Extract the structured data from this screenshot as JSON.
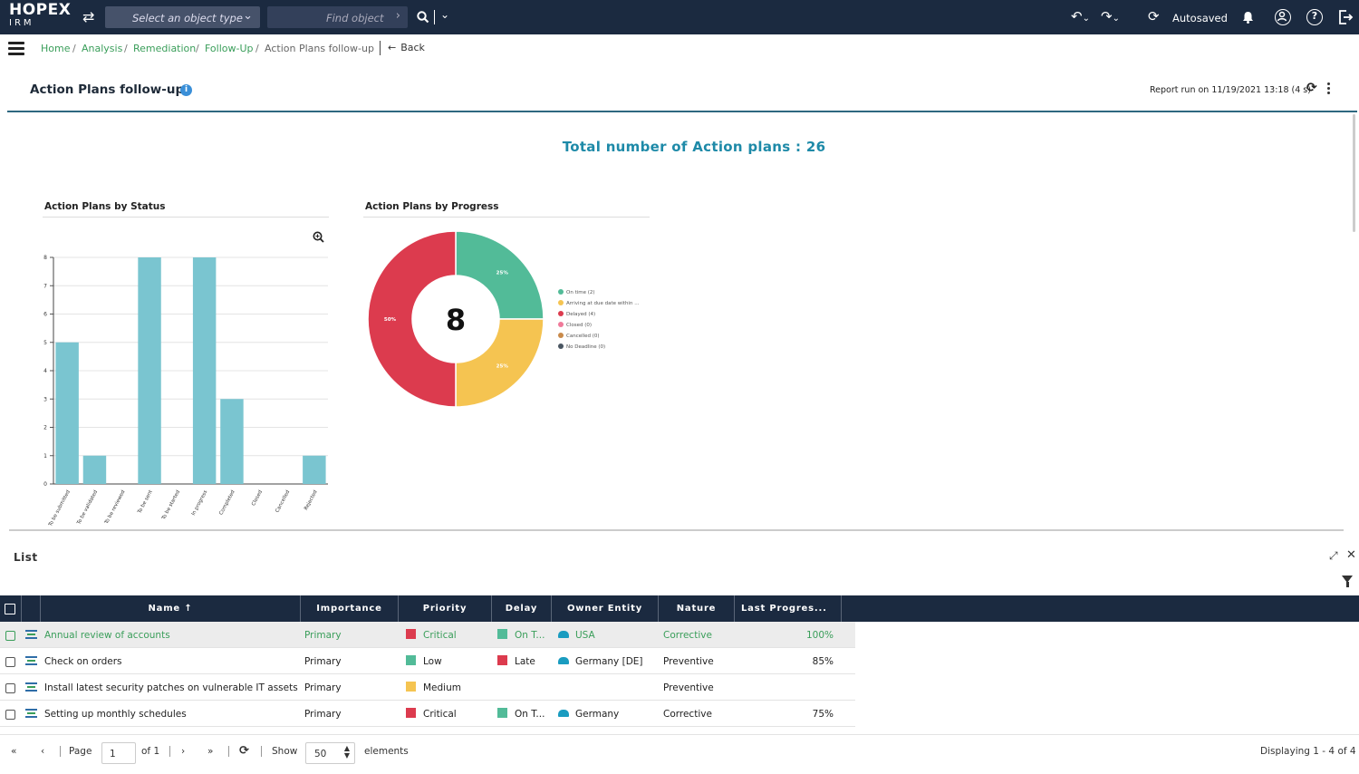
{
  "app": {
    "logo": "HOPEX",
    "logo_sub": "IRM"
  },
  "topbar": {
    "select_type_placeholder": "Select an object type",
    "find_placeholder": "Find object",
    "autosaved": "Autosaved",
    "help_symbol": "?",
    "icons": [
      "swap-icon",
      "chevron-down-icon",
      "chevron-right-icon",
      "search-icon",
      "undo-icon",
      "redo-icon",
      "sync-icon",
      "bell-icon",
      "user-icon",
      "help-icon",
      "logout-icon"
    ]
  },
  "breadcrumb": {
    "items": [
      "Home",
      "Analysis",
      "Remediation",
      "Follow-Up",
      "Action Plans follow-up"
    ],
    "separator": "/",
    "back": "Back"
  },
  "page": {
    "title": "Action Plans follow-up",
    "info_symbol": "i",
    "report_run": "Report run on 11/19/2021 13:18 (4 s)",
    "total": "Total number of Action plans : 26"
  },
  "charts": {
    "bar_title": "Action Plans by Status",
    "donut_title": "Action Plans by Progress"
  },
  "chart_data": [
    {
      "type": "bar",
      "title": "Action Plans by Status",
      "categories": [
        "To be submitted",
        "To be validated",
        "To be reviewed",
        "To be sent",
        "To be started",
        "In progress",
        "Completed",
        "Closed",
        "Cancelled",
        "Rejected"
      ],
      "values": [
        5,
        1,
        0,
        8,
        0,
        8,
        3,
        0,
        0,
        1
      ],
      "ylim": [
        0,
        8
      ],
      "yticks": [
        0,
        1,
        2,
        3,
        4,
        5,
        6,
        7,
        8
      ],
      "grid": true,
      "color": "#7ac5d0"
    },
    {
      "type": "pie",
      "title": "Action Plans by Progress",
      "center_label": "8",
      "labels": [
        "On time (2)",
        "Arriving at due date within ...",
        "Delayed (4)",
        "Closed (0)",
        "Cancelled (0)",
        "No Deadline (0)"
      ],
      "values": [
        2,
        2,
        4,
        0,
        0,
        0
      ],
      "percent_labels": [
        "25%",
        "25%",
        "50%",
        "",
        "",
        ""
      ],
      "colors": [
        "#52bb98",
        "#f5c451",
        "#dc3b4e",
        "#f07a9a",
        "#c98a4a",
        "#4a5662"
      ],
      "legend": "right"
    }
  ],
  "list": {
    "title": "List",
    "columns": [
      "Name",
      "Importance",
      "Priority",
      "Delay",
      "Owner Entity",
      "Nature",
      "Last Progres..."
    ],
    "sort_indicator": "↑",
    "rows": [
      {
        "name": "Annual review of accounts",
        "importance": "Primary",
        "priority": "Critical",
        "priority_color": "#dc3b4e",
        "delay": "On T...",
        "delay_color": "#52bb98",
        "entity": "USA",
        "nature": "Corrective",
        "progress": "100%",
        "selected": true
      },
      {
        "name": "Check on orders",
        "importance": "Primary",
        "priority": "Low",
        "priority_color": "#52bb98",
        "delay": "Late",
        "delay_color": "#dc3b4e",
        "entity": "Germany [DE]",
        "nature": "Preventive",
        "progress": "85%",
        "selected": false
      },
      {
        "name": "Install latest security patches on vulnerable IT assets",
        "importance": "Primary",
        "priority": "Medium",
        "priority_color": "#f5c451",
        "delay": "",
        "delay_color": "",
        "entity": "",
        "nature": "Preventive",
        "progress": "",
        "selected": false
      },
      {
        "name": "Setting up monthly schedules",
        "importance": "Primary",
        "priority": "Critical",
        "priority_color": "#dc3b4e",
        "delay": "On T...",
        "delay_color": "#52bb98",
        "entity": "Germany",
        "nature": "Corrective",
        "progress": "75%",
        "selected": false
      }
    ]
  },
  "footer": {
    "page_label": "Page",
    "page_value": "1",
    "of": "of 1",
    "show_label": "Show",
    "show_value": "50",
    "elements": "elements",
    "displaying": "Displaying 1 - 4 of 4"
  },
  "colors": {
    "topbar": "#1b2a40",
    "link": "#3a9e5a",
    "accent": "#1e8aa8"
  }
}
